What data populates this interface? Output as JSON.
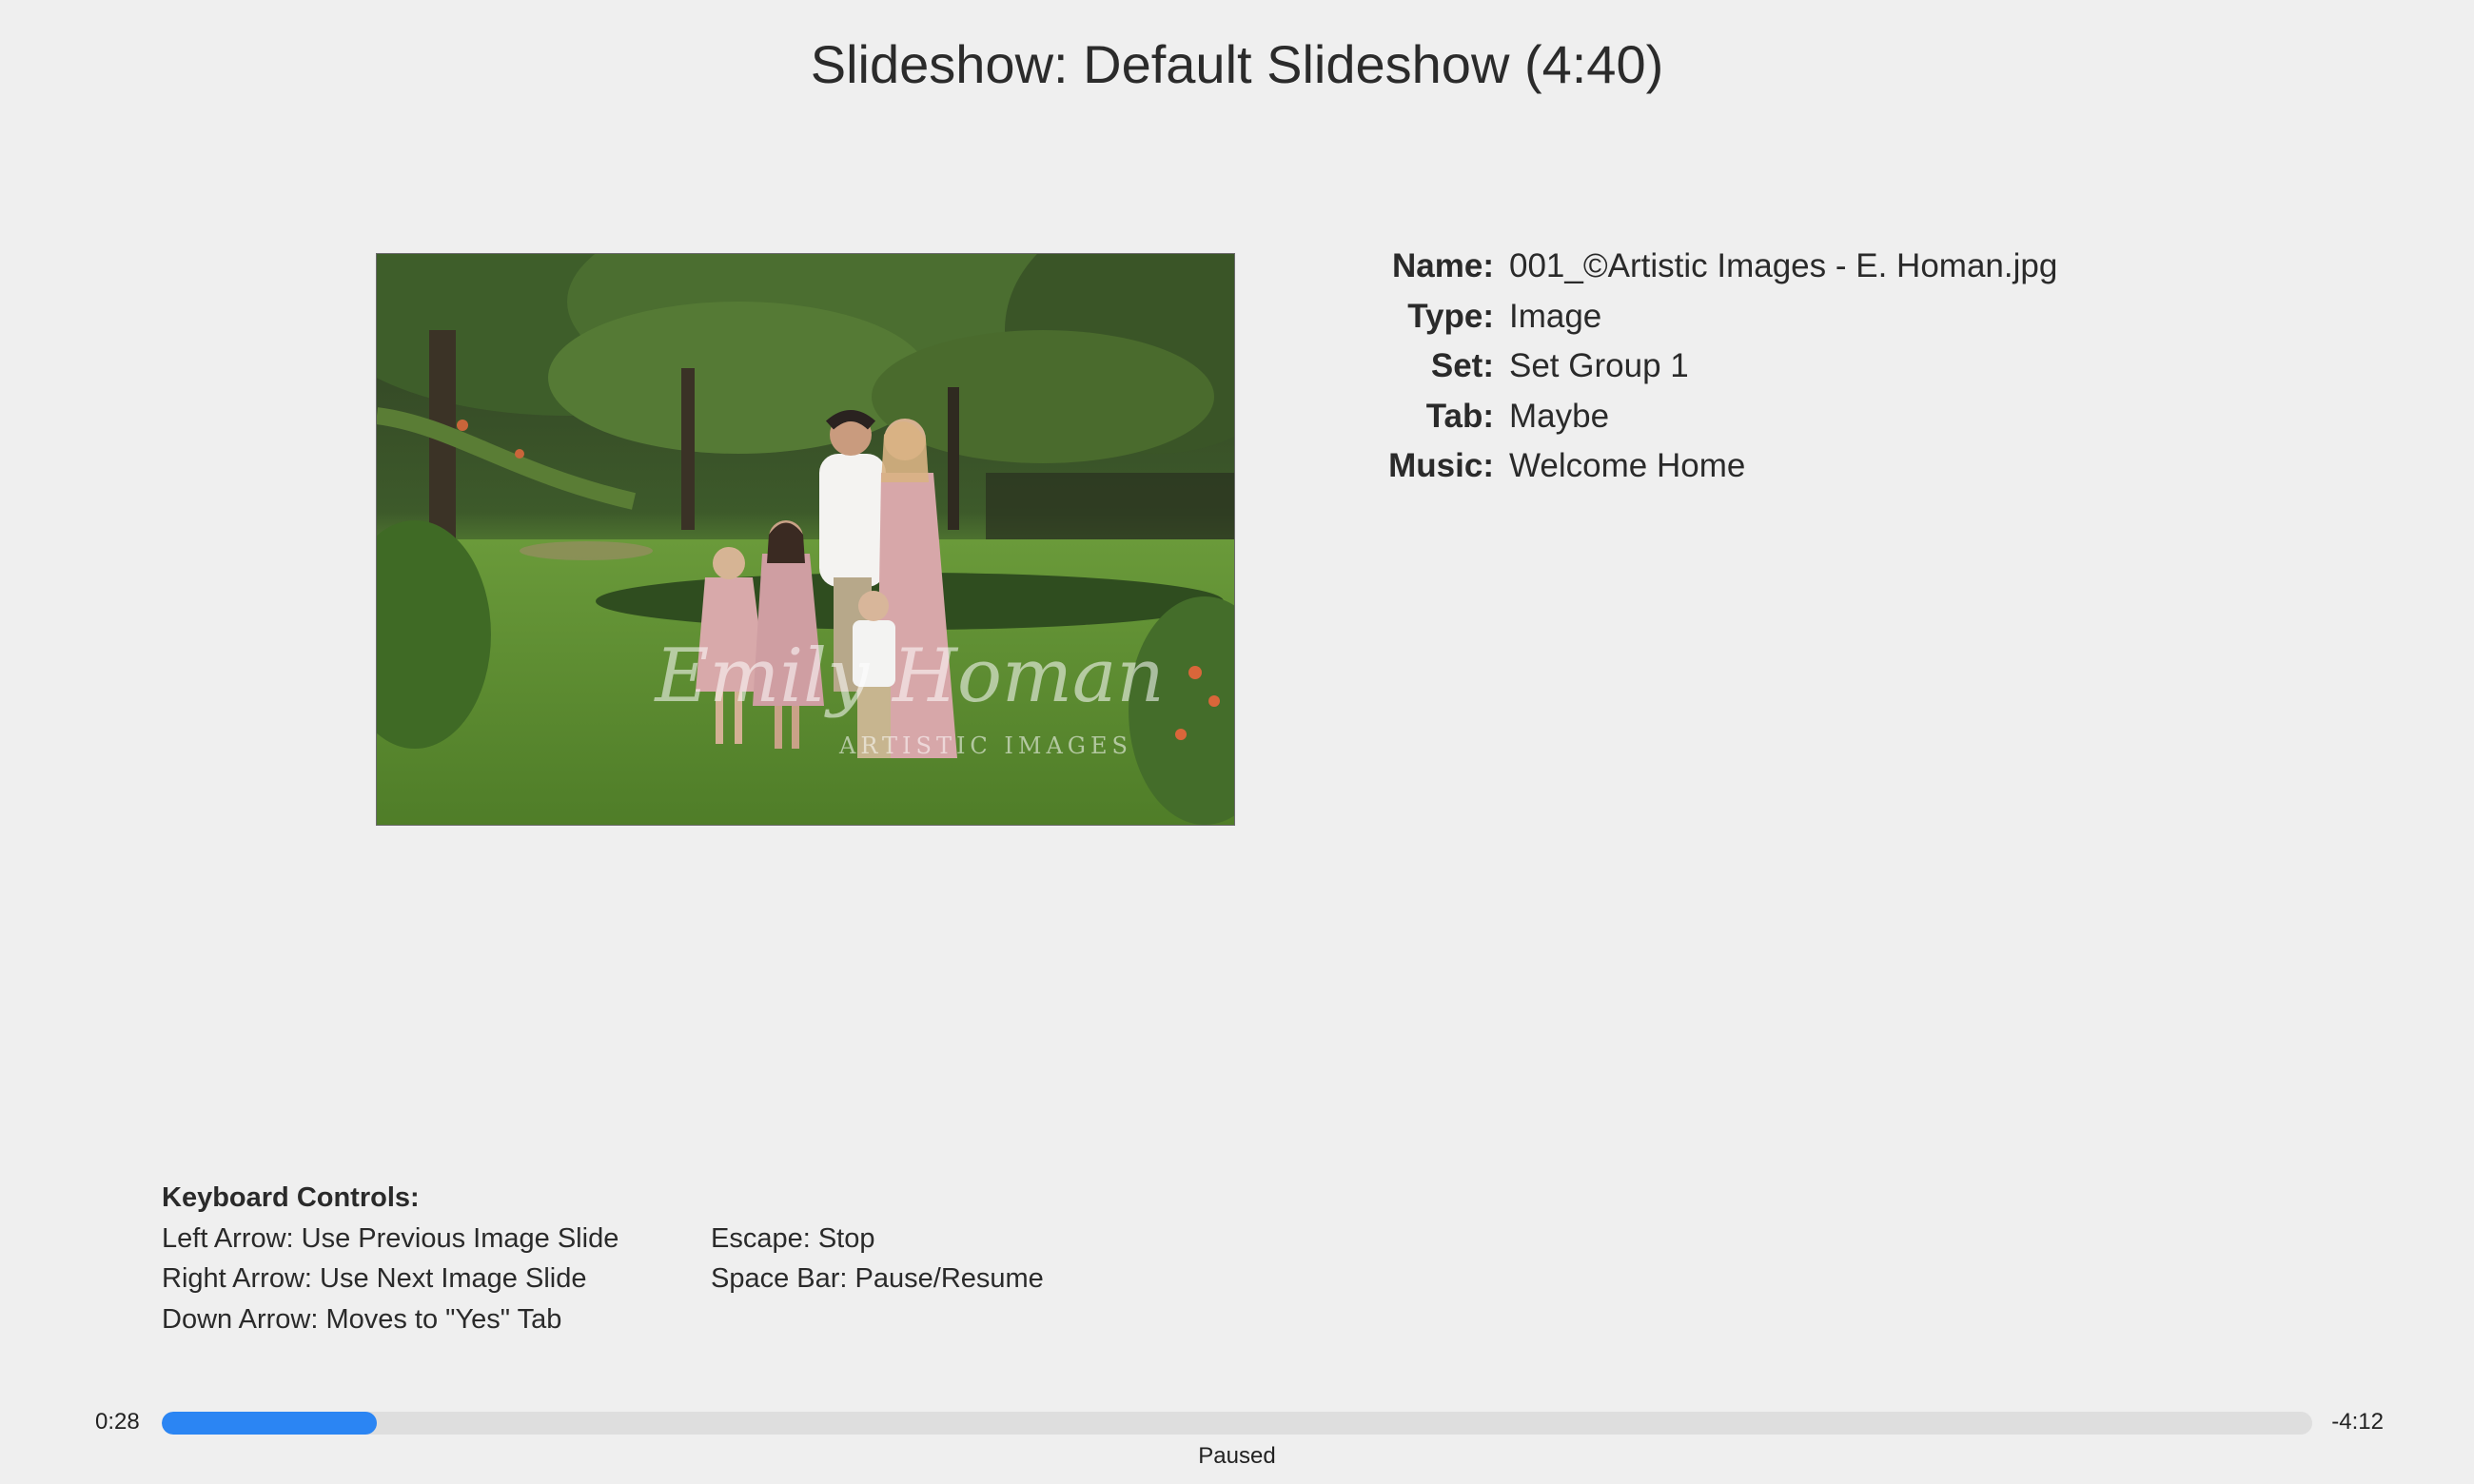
{
  "window": {
    "title": "Slideshow: Default Slideshow (4:40)"
  },
  "photo": {
    "alt": "Family photo in garden",
    "watermark_line1": "Emily Homan",
    "watermark_line2": "ARTISTIC IMAGES"
  },
  "info": {
    "name_label": "Name:",
    "name_value": "001_©Artistic Images - E. Homan.jpg",
    "type_label": "Type:",
    "type_value": "Image",
    "set_label": "Set:",
    "set_value": "Set Group 1",
    "tab_label": "Tab:",
    "tab_value": "Maybe",
    "music_label": "Music:",
    "music_value": "Welcome Home"
  },
  "keyboard": {
    "heading": "Keyboard Controls:",
    "left": [
      "Left Arrow: Use Previous Image Slide",
      "Right Arrow: Use Next Image Slide",
      "Down Arrow: Moves to \"Yes\" Tab"
    ],
    "right": [
      "Escape: Stop",
      "Space Bar: Pause/Resume"
    ]
  },
  "playback": {
    "elapsed": "0:28",
    "remaining": "-4:12",
    "progress_fraction": 0.1,
    "status": "Paused",
    "accent_color": "#2b85f3"
  }
}
